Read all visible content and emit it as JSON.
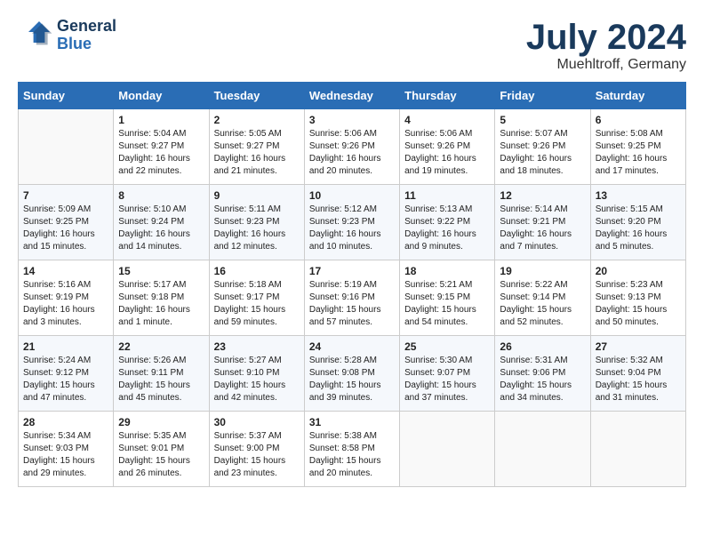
{
  "header": {
    "logo_line1": "General",
    "logo_line2": "Blue",
    "month": "July 2024",
    "location": "Muehltroff, Germany"
  },
  "days_of_week": [
    "Sunday",
    "Monday",
    "Tuesday",
    "Wednesday",
    "Thursday",
    "Friday",
    "Saturday"
  ],
  "weeks": [
    [
      {
        "day": "",
        "info": ""
      },
      {
        "day": "1",
        "info": "Sunrise: 5:04 AM\nSunset: 9:27 PM\nDaylight: 16 hours\nand 22 minutes."
      },
      {
        "day": "2",
        "info": "Sunrise: 5:05 AM\nSunset: 9:27 PM\nDaylight: 16 hours\nand 21 minutes."
      },
      {
        "day": "3",
        "info": "Sunrise: 5:06 AM\nSunset: 9:26 PM\nDaylight: 16 hours\nand 20 minutes."
      },
      {
        "day": "4",
        "info": "Sunrise: 5:06 AM\nSunset: 9:26 PM\nDaylight: 16 hours\nand 19 minutes."
      },
      {
        "day": "5",
        "info": "Sunrise: 5:07 AM\nSunset: 9:26 PM\nDaylight: 16 hours\nand 18 minutes."
      },
      {
        "day": "6",
        "info": "Sunrise: 5:08 AM\nSunset: 9:25 PM\nDaylight: 16 hours\nand 17 minutes."
      }
    ],
    [
      {
        "day": "7",
        "info": "Sunrise: 5:09 AM\nSunset: 9:25 PM\nDaylight: 16 hours\nand 15 minutes."
      },
      {
        "day": "8",
        "info": "Sunrise: 5:10 AM\nSunset: 9:24 PM\nDaylight: 16 hours\nand 14 minutes."
      },
      {
        "day": "9",
        "info": "Sunrise: 5:11 AM\nSunset: 9:23 PM\nDaylight: 16 hours\nand 12 minutes."
      },
      {
        "day": "10",
        "info": "Sunrise: 5:12 AM\nSunset: 9:23 PM\nDaylight: 16 hours\nand 10 minutes."
      },
      {
        "day": "11",
        "info": "Sunrise: 5:13 AM\nSunset: 9:22 PM\nDaylight: 16 hours\nand 9 minutes."
      },
      {
        "day": "12",
        "info": "Sunrise: 5:14 AM\nSunset: 9:21 PM\nDaylight: 16 hours\nand 7 minutes."
      },
      {
        "day": "13",
        "info": "Sunrise: 5:15 AM\nSunset: 9:20 PM\nDaylight: 16 hours\nand 5 minutes."
      }
    ],
    [
      {
        "day": "14",
        "info": "Sunrise: 5:16 AM\nSunset: 9:19 PM\nDaylight: 16 hours\nand 3 minutes."
      },
      {
        "day": "15",
        "info": "Sunrise: 5:17 AM\nSunset: 9:18 PM\nDaylight: 16 hours\nand 1 minute."
      },
      {
        "day": "16",
        "info": "Sunrise: 5:18 AM\nSunset: 9:17 PM\nDaylight: 15 hours\nand 59 minutes."
      },
      {
        "day": "17",
        "info": "Sunrise: 5:19 AM\nSunset: 9:16 PM\nDaylight: 15 hours\nand 57 minutes."
      },
      {
        "day": "18",
        "info": "Sunrise: 5:21 AM\nSunset: 9:15 PM\nDaylight: 15 hours\nand 54 minutes."
      },
      {
        "day": "19",
        "info": "Sunrise: 5:22 AM\nSunset: 9:14 PM\nDaylight: 15 hours\nand 52 minutes."
      },
      {
        "day": "20",
        "info": "Sunrise: 5:23 AM\nSunset: 9:13 PM\nDaylight: 15 hours\nand 50 minutes."
      }
    ],
    [
      {
        "day": "21",
        "info": "Sunrise: 5:24 AM\nSunset: 9:12 PM\nDaylight: 15 hours\nand 47 minutes."
      },
      {
        "day": "22",
        "info": "Sunrise: 5:26 AM\nSunset: 9:11 PM\nDaylight: 15 hours\nand 45 minutes."
      },
      {
        "day": "23",
        "info": "Sunrise: 5:27 AM\nSunset: 9:10 PM\nDaylight: 15 hours\nand 42 minutes."
      },
      {
        "day": "24",
        "info": "Sunrise: 5:28 AM\nSunset: 9:08 PM\nDaylight: 15 hours\nand 39 minutes."
      },
      {
        "day": "25",
        "info": "Sunrise: 5:30 AM\nSunset: 9:07 PM\nDaylight: 15 hours\nand 37 minutes."
      },
      {
        "day": "26",
        "info": "Sunrise: 5:31 AM\nSunset: 9:06 PM\nDaylight: 15 hours\nand 34 minutes."
      },
      {
        "day": "27",
        "info": "Sunrise: 5:32 AM\nSunset: 9:04 PM\nDaylight: 15 hours\nand 31 minutes."
      }
    ],
    [
      {
        "day": "28",
        "info": "Sunrise: 5:34 AM\nSunset: 9:03 PM\nDaylight: 15 hours\nand 29 minutes."
      },
      {
        "day": "29",
        "info": "Sunrise: 5:35 AM\nSunset: 9:01 PM\nDaylight: 15 hours\nand 26 minutes."
      },
      {
        "day": "30",
        "info": "Sunrise: 5:37 AM\nSunset: 9:00 PM\nDaylight: 15 hours\nand 23 minutes."
      },
      {
        "day": "31",
        "info": "Sunrise: 5:38 AM\nSunset: 8:58 PM\nDaylight: 15 hours\nand 20 minutes."
      },
      {
        "day": "",
        "info": ""
      },
      {
        "day": "",
        "info": ""
      },
      {
        "day": "",
        "info": ""
      }
    ]
  ]
}
